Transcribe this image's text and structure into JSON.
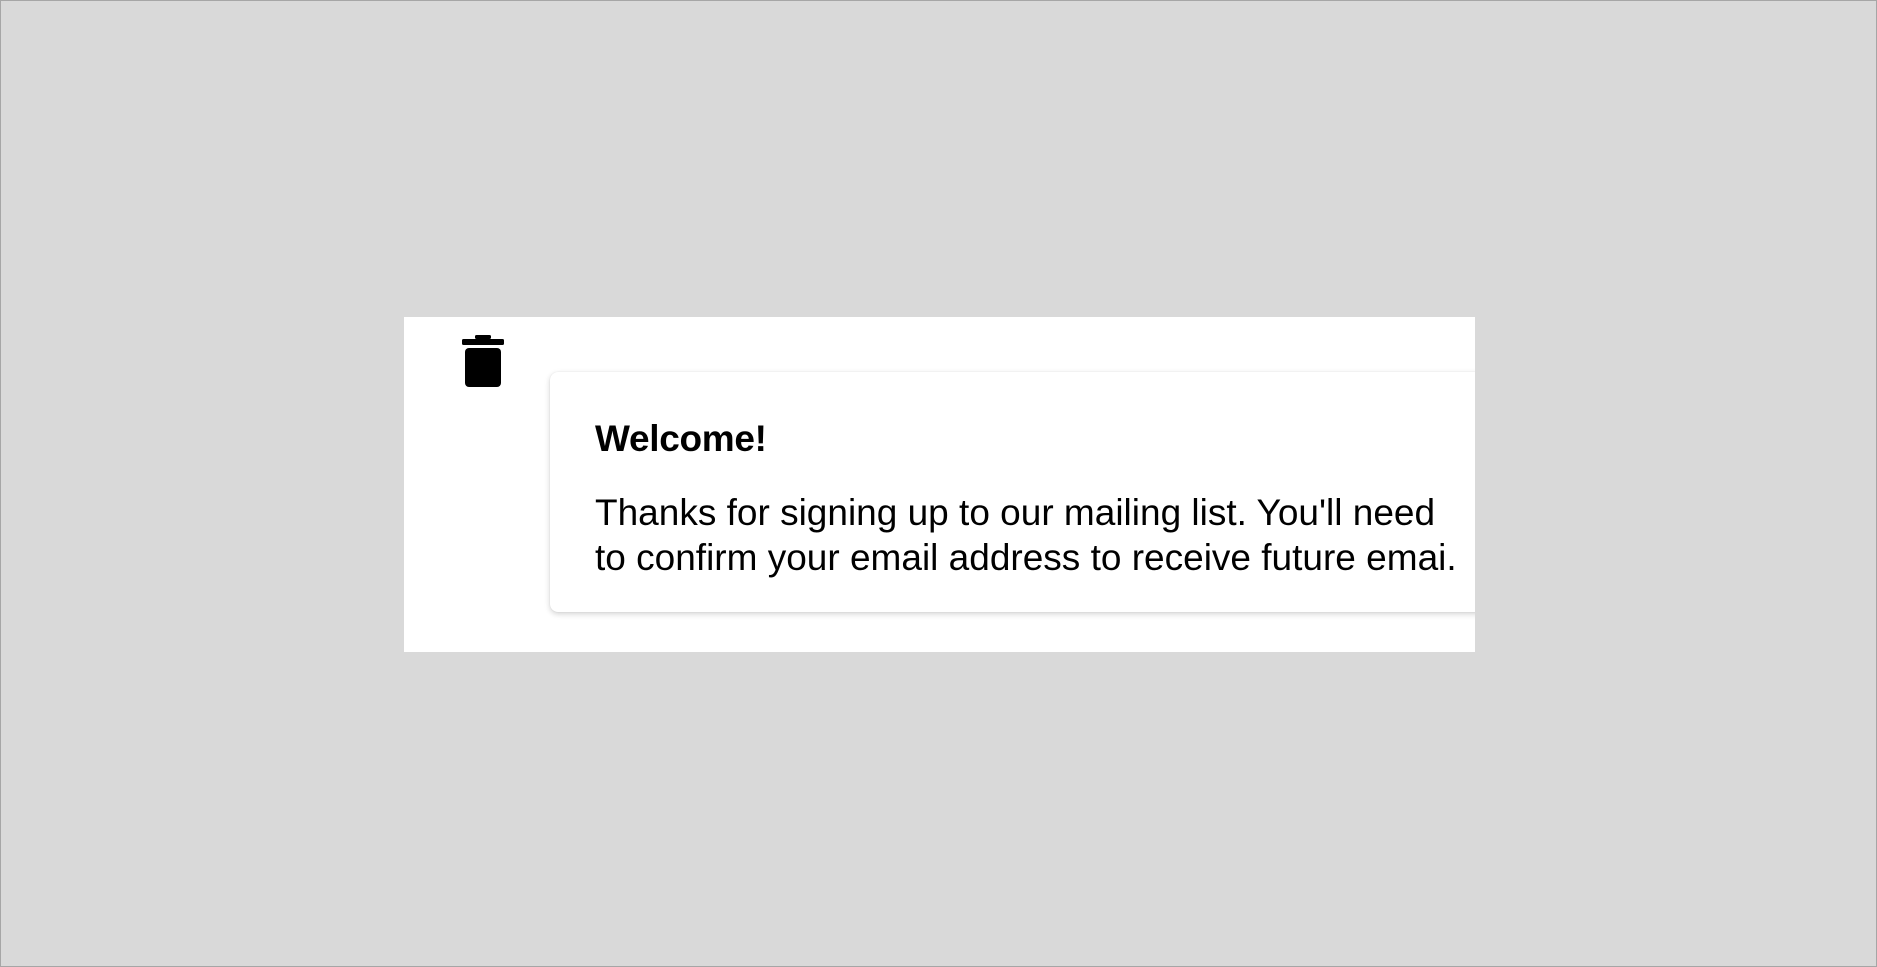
{
  "colors": {
    "backdrop": "#d9d9d9",
    "panel": "#ffffff",
    "text": "#000000",
    "icon": "#000000"
  },
  "toolbar": {
    "delete_icon": "trash-icon"
  },
  "notification": {
    "title": "Welcome!",
    "body_line_1": "Thanks for signing up to our mailing list. You'll need",
    "body_line_2": "to confirm your email address to receive future emai."
  }
}
